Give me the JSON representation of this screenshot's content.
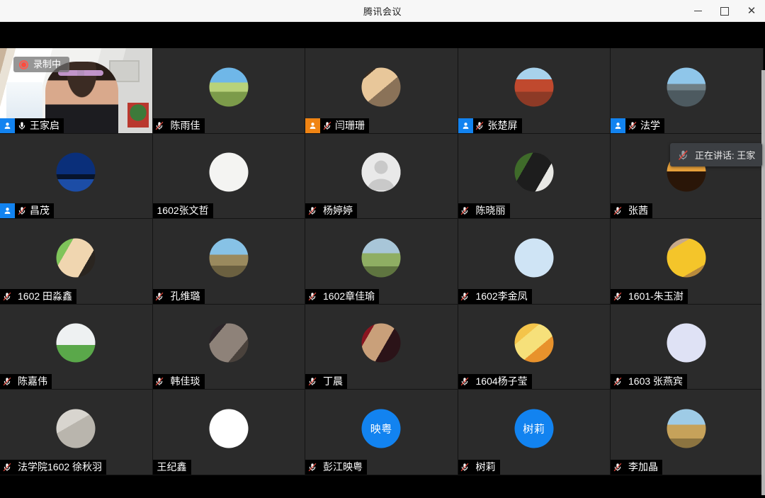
{
  "window": {
    "title": "腾讯会议",
    "minimize_label": "",
    "maximize_label": "",
    "close_label": "✕"
  },
  "recording": {
    "label": "录制中"
  },
  "tooltip": {
    "text": "正在讲话: 王家"
  },
  "colors": {
    "host_badge": "#1283f0",
    "cohost_badge": "#f08413",
    "active_speaker_border": "#2bbf5a",
    "recording_dot": "#ff4b3d",
    "cell_background": "#2b2b2b",
    "titlebar_background": "#f7f7f7"
  },
  "participants": [
    {
      "name": "王家启",
      "badge": "host",
      "mic": "on",
      "avatar": "video",
      "active": true
    },
    {
      "name": "陈雨佳",
      "badge": "none",
      "mic": "muted",
      "avatar": "photo-field"
    },
    {
      "name": "闫珊珊",
      "badge": "cohost",
      "mic": "muted",
      "avatar": "photo-illustration"
    },
    {
      "name": "张楚屏",
      "badge": "host",
      "mic": "muted",
      "avatar": "photo-palace"
    },
    {
      "name": "法学",
      "badge": "host",
      "mic": "muted",
      "avatar": "photo-road"
    },
    {
      "name": "昌茂",
      "badge": "host",
      "mic": "muted",
      "avatar": "photo-night-sky"
    },
    {
      "name": "1602张文哲",
      "badge": "none",
      "mic": "none",
      "avatar": "sketch-figure"
    },
    {
      "name": "杨婷婷",
      "badge": "none",
      "mic": "muted",
      "avatar": "generic"
    },
    {
      "name": "陈晓丽",
      "badge": "none",
      "mic": "muted",
      "avatar": "photo-panda"
    },
    {
      "name": "张茜",
      "badge": "none",
      "mic": "muted",
      "avatar": "photo-sunset"
    },
    {
      "name": "1602 田淼鑫",
      "badge": "none",
      "mic": "muted",
      "avatar": "anime-luffy"
    },
    {
      "name": "孔维璐",
      "badge": "none",
      "mic": "muted",
      "avatar": "photo-grassland"
    },
    {
      "name": "1602章佳瑜",
      "badge": "none",
      "mic": "muted",
      "avatar": "photo-girl-dog"
    },
    {
      "name": "1602李金凤",
      "badge": "none",
      "mic": "muted",
      "avatar": "cartoon-bear"
    },
    {
      "name": "1601-朱玉澍",
      "badge": "none",
      "mic": "muted",
      "avatar": "photo-duck"
    },
    {
      "name": "陈嘉伟",
      "badge": "none",
      "mic": "muted",
      "avatar": "photo-baby"
    },
    {
      "name": "韩佳琰",
      "badge": "none",
      "mic": "muted",
      "avatar": "photo-cat"
    },
    {
      "name": "丁晨",
      "badge": "none",
      "mic": "muted",
      "avatar": "anime-boy"
    },
    {
      "name": "1604杨子莹",
      "badge": "none",
      "mic": "muted",
      "avatar": "cartoon-yellow"
    },
    {
      "name": "1603 张燕宾",
      "badge": "none",
      "mic": "muted",
      "avatar": "cartoon-bear-purple"
    },
    {
      "name": "法学院1602 徐秋羽",
      "badge": "none",
      "mic": "muted",
      "avatar": "photo-calligraphy"
    },
    {
      "name": "王纪鑫",
      "badge": "none",
      "mic": "none",
      "avatar": "cartoon-hamster"
    },
    {
      "name": "彭江映粤",
      "badge": "none",
      "mic": "muted",
      "avatar": "initials",
      "initials": "映粤"
    },
    {
      "name": "树莉",
      "badge": "none",
      "mic": "muted",
      "avatar": "initials",
      "initials": "树莉"
    },
    {
      "name": "李加晶",
      "badge": "none",
      "mic": "muted",
      "avatar": "photo-field-person"
    }
  ]
}
